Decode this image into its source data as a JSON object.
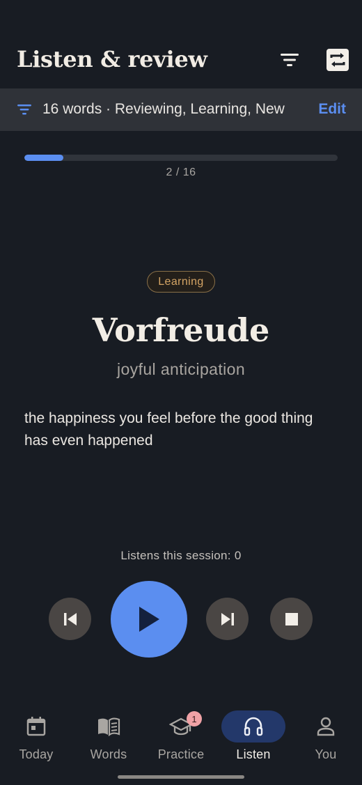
{
  "header": {
    "title": "Listen & review",
    "filter_icon": "filter-icon",
    "shuffle_icon": "repeat-icon"
  },
  "filter_bar": {
    "summary": "16 words · Reviewing, Learning, New",
    "edit_label": "Edit"
  },
  "progress": {
    "current": 2,
    "total": 16,
    "label": "2 / 16",
    "fraction": 0.125
  },
  "card": {
    "status": "Learning",
    "term": "Vorfreude",
    "translation": "joyful anticipation",
    "definition": "the happiness you feel before the good thing has even happened"
  },
  "session": {
    "listens_label": "Listens this session: 0"
  },
  "controls": {
    "prev_icon": "skip-previous-icon",
    "play_icon": "play-icon",
    "next_icon": "skip-next-icon",
    "stop_icon": "stop-icon"
  },
  "nav": {
    "items": [
      {
        "label": "Today",
        "icon": "calendar-icon"
      },
      {
        "label": "Words",
        "icon": "book-icon"
      },
      {
        "label": "Practice",
        "icon": "graduation-cap-icon",
        "badge": "1"
      },
      {
        "label": "Listen",
        "icon": "headphones-icon",
        "active": true
      },
      {
        "label": "You",
        "icon": "person-icon"
      }
    ]
  },
  "colors": {
    "background": "#181c23",
    "accent": "#5b8ef0",
    "filter_bar": "#2f3238",
    "status_learning": "#d5a565",
    "nav_active": "#23386a",
    "badge": "#f0a2a6"
  }
}
